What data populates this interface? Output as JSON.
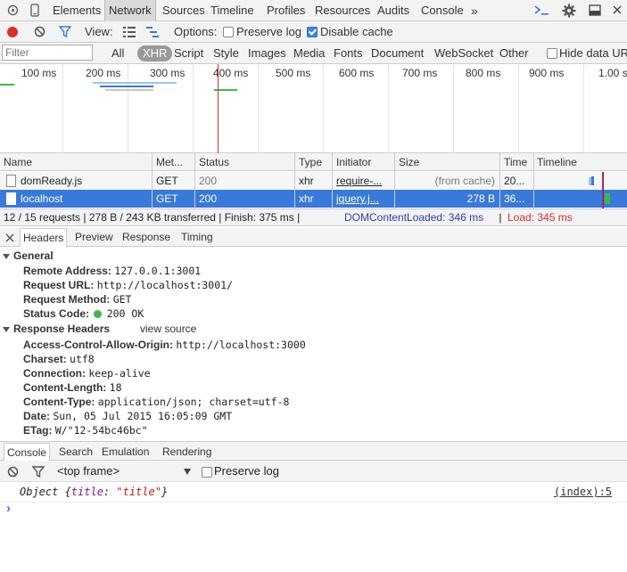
{
  "tabs": [
    "Elements",
    "Network",
    "Sources",
    "Timeline",
    "Profiles",
    "Resources",
    "Audits",
    "Console"
  ],
  "more_tabs_glyph": "»",
  "toolbar": {
    "view_label": "View:",
    "options_label": "Options:",
    "preserve_log": "Preserve log",
    "disable_cache": "Disable cache"
  },
  "filter": {
    "placeholder": "Filter",
    "types": [
      "All",
      "XHR",
      "Script",
      "Style",
      "Images",
      "Media",
      "Fonts",
      "Document",
      "WebSocket",
      "Other"
    ],
    "selected": "XHR",
    "hide_data_urls": "Hide data URL"
  },
  "overview": {
    "ticks": [
      "100 ms",
      "200 ms",
      "300 ms",
      "400 ms",
      "500 ms",
      "600 ms",
      "700 ms",
      "800 ms",
      "900 ms",
      "1.00 s"
    ]
  },
  "table": {
    "columns": [
      "Name",
      "Met...",
      "Status",
      "Type",
      "Initiator",
      "Size",
      "Time",
      "Timeline"
    ],
    "rows": [
      {
        "name": "domReady.js",
        "method": "GET",
        "status": "200",
        "type": "xhr",
        "initiator": "require-...",
        "size": "(from cache)",
        "time": "20..."
      },
      {
        "name": "localhost",
        "method": "GET",
        "status": "200",
        "type": "xhr",
        "initiator": "jquery.j...",
        "size": "278 B",
        "time": "36..."
      }
    ]
  },
  "summary": {
    "main": "12 / 15 requests | 278 B / 243 KB transferred | Finish: 375 ms | ",
    "dcl": "DOMContentLoaded: 346 ms",
    "sep": " | ",
    "load": "Load: 345 ms"
  },
  "detail_tabs": [
    "Headers",
    "Preview",
    "Response",
    "Timing"
  ],
  "headers": {
    "general_title": "General",
    "general": [
      {
        "k": "Remote Address:",
        "v": "127.0.0.1:3001"
      },
      {
        "k": "Request URL:",
        "v": "http://localhost:3001/"
      },
      {
        "k": "Request Method:",
        "v": "GET"
      },
      {
        "k": "Status Code:",
        "v": "200 OK"
      }
    ],
    "response_title": "Response Headers",
    "view_source": "view source",
    "response": [
      {
        "k": "Access-Control-Allow-Origin:",
        "v": "http://localhost:3000"
      },
      {
        "k": "Charset:",
        "v": "utf8"
      },
      {
        "k": "Connection:",
        "v": "keep-alive"
      },
      {
        "k": "Content-Length:",
        "v": "18"
      },
      {
        "k": "Content-Type:",
        "v": "application/json; charset=utf-8"
      },
      {
        "k": "Date:",
        "v": "Sun, 05 Jul 2015 16:05:09 GMT"
      },
      {
        "k": "ETag:",
        "v": "W/\"12-54bc46bc\""
      }
    ]
  },
  "console": {
    "tabs": [
      "Console",
      "Search",
      "Emulation",
      "Rendering"
    ],
    "frame": "<top frame>",
    "preserve_log": "Preserve log",
    "object_prefix": "Object {",
    "object_key": "title",
    "object_colon": ": ",
    "object_value": "\"title\"",
    "object_suffix": "}",
    "source_link": "(index):5",
    "prompt": "›"
  },
  "colors": {
    "accent": "#3879d9",
    "record": "#d9302c",
    "load_line": "#d32f2f",
    "dcl_line": "#2c3eaf"
  }
}
